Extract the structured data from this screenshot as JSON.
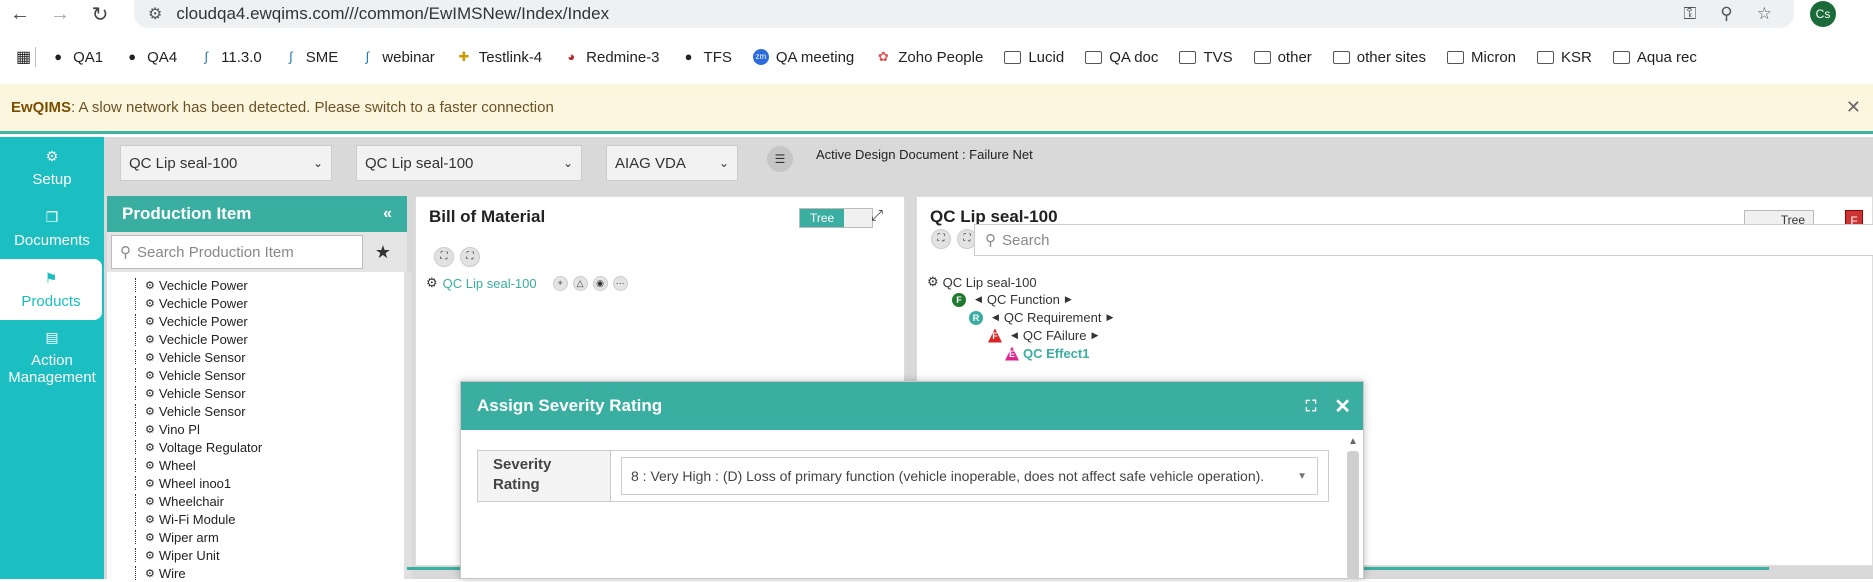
{
  "browser": {
    "url": "cloudqa4.ewqims.com///common/EwIMSNew/Index/Index",
    "avatar": "Cs"
  },
  "bookmarks": [
    {
      "label": "QA1",
      "icon": "globe-icon"
    },
    {
      "label": "QA4",
      "icon": "globe-icon"
    },
    {
      "label": "11.3.0",
      "icon": "ewqims-icon"
    },
    {
      "label": "SME",
      "icon": "ewqims-icon"
    },
    {
      "label": "webinar",
      "icon": "ewqims-icon"
    },
    {
      "label": "Testlink-4",
      "icon": "testlink-icon"
    },
    {
      "label": "Redmine-3",
      "icon": "redmine-icon"
    },
    {
      "label": "TFS",
      "icon": "globe-icon"
    },
    {
      "label": "QA meeting",
      "icon": "zoom-icon"
    },
    {
      "label": "Zoho People",
      "icon": "zoho-icon"
    },
    {
      "label": "Lucid",
      "icon": "folder-icon"
    },
    {
      "label": "QA doc",
      "icon": "folder-icon"
    },
    {
      "label": "TVS",
      "icon": "folder-icon"
    },
    {
      "label": "other",
      "icon": "folder-icon"
    },
    {
      "label": "other sites",
      "icon": "folder-icon"
    },
    {
      "label": "Micron",
      "icon": "folder-icon"
    },
    {
      "label": "KSR",
      "icon": "folder-icon"
    },
    {
      "label": "Aqua rec",
      "icon": "folder-icon"
    }
  ],
  "banner": {
    "brand": "EwQIMS",
    "message": " : A slow network has been detected. Please switch to a faster connection"
  },
  "sidebar": {
    "items": [
      {
        "label": "Setup"
      },
      {
        "label": "Documents"
      },
      {
        "label": "Products"
      },
      {
        "label": "Action Management"
      }
    ]
  },
  "topbar": {
    "select1": "QC Lip seal-100",
    "select2": "QC Lip seal-100",
    "select3": "AIAG VDA",
    "active_doc": "Active Design Document : Failure Net"
  },
  "production": {
    "title": "Production Item",
    "search_placeholder": "Search Production Item",
    "items": [
      "Vechicle Power",
      "Vechicle Power",
      "Vechicle Power",
      "Vechicle Power",
      "Vehicle Sensor",
      "Vehicle Sensor",
      "Vehicle Sensor",
      "Vehicle Sensor",
      "Vino Pl",
      "Voltage Regulator",
      "Wheel",
      "Wheel inoo1",
      "Wheelchair",
      "Wi-Fi Module",
      "Wiper arm",
      "Wiper Unit",
      "Wire"
    ]
  },
  "bom": {
    "title": "Bill of Material",
    "toggle": "Tree",
    "root": "QC Lip seal-100"
  },
  "failure": {
    "title": "QC Lip seal-100",
    "toggle": "Tree",
    "f_button": "F",
    "search_placeholder": "Search",
    "root": "QC Lip seal-100",
    "function": "QC Function",
    "requirement": "QC Requirement",
    "failure": "QC FAilure",
    "effect": "QC Effect1"
  },
  "modal": {
    "title": "Assign Severity Rating",
    "label": "Severity Rating",
    "value": "8 : Very High : (D) Loss of primary function (vehicle inoperable, does not affect safe vehicle operation)."
  },
  "colors": {
    "teal": "#3aaea0",
    "sidebar": "#1bbfc2",
    "banner_bg": "#fdf6df"
  }
}
